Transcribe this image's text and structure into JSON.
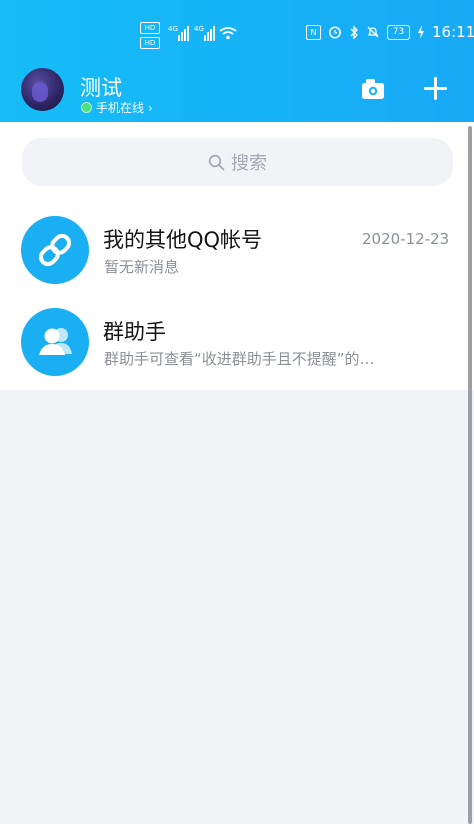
{
  "status_bar": {
    "sim1": "HD",
    "sim2": "HD",
    "network1": "4G",
    "network2": "4G",
    "battery": "73",
    "time": "16:11"
  },
  "header": {
    "username": "测试",
    "status": "手机在线",
    "status_arrow": "›",
    "camera_icon": "camera-icon",
    "plus_icon": "plus-icon"
  },
  "search": {
    "placeholder": "搜索"
  },
  "conversations": [
    {
      "title": "我的其他QQ帐号",
      "subtitle": "暂无新消息",
      "time": "2020-12-23",
      "icon": "link-icon"
    },
    {
      "title": "群助手",
      "subtitle": "群助手可查看“收进群助手且不提醒”的…",
      "icon": "group-icon"
    }
  ],
  "colors": {
    "header_gradient_start": "#17bdf7",
    "header_gradient_end": "#19a9f6",
    "icon_circle": "#1aaef3",
    "online_dot": "#4fe07f"
  }
}
